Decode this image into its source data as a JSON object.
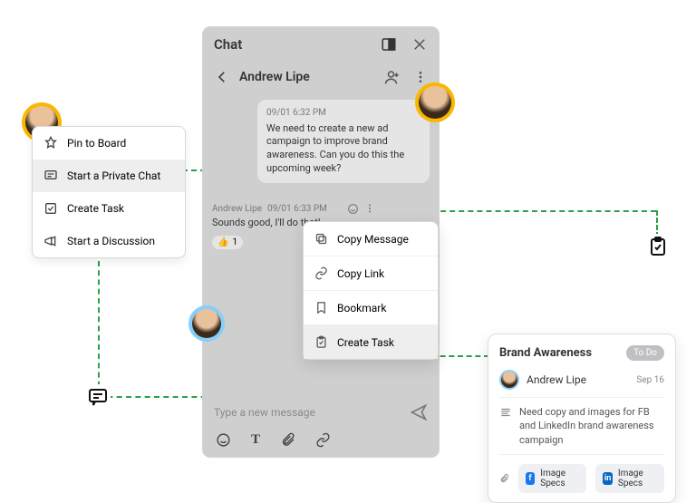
{
  "left_menu": {
    "items": [
      {
        "label": "Pin to Board"
      },
      {
        "label": "Start a Private Chat"
      },
      {
        "label": "Create Task"
      },
      {
        "label": "Start a Discussion"
      }
    ]
  },
  "chat": {
    "title": "Chat",
    "contact": "Andrew Lipe",
    "incoming": {
      "timestamp": "09/01 6:32 PM",
      "text": "We need to create a new ad campaign to improve brand awareness. Can you do this the upcoming week?"
    },
    "outgoing": {
      "author": "Andrew Lipe",
      "timestamp": "09/01 6:33 PM",
      "text": "Sounds good, I'll do that!",
      "reaction": {
        "emoji": "👍",
        "count": "1"
      }
    },
    "compose_placeholder": "Type a new message"
  },
  "ctx_menu": {
    "items": [
      {
        "label": "Copy Message"
      },
      {
        "label": "Copy Link"
      },
      {
        "label": "Bookmark"
      },
      {
        "label": "Create Task"
      }
    ]
  },
  "task": {
    "title": "Brand Awareness",
    "status": "To Do",
    "assignee": "Andrew Lipe",
    "due": "Sep 16",
    "description": "Need copy and images for FB and LinkedIn brand awareness campaign",
    "attachments": [
      {
        "label": "Image Specs",
        "net": "fb"
      },
      {
        "label": "Image Specs",
        "net": "li"
      }
    ]
  }
}
